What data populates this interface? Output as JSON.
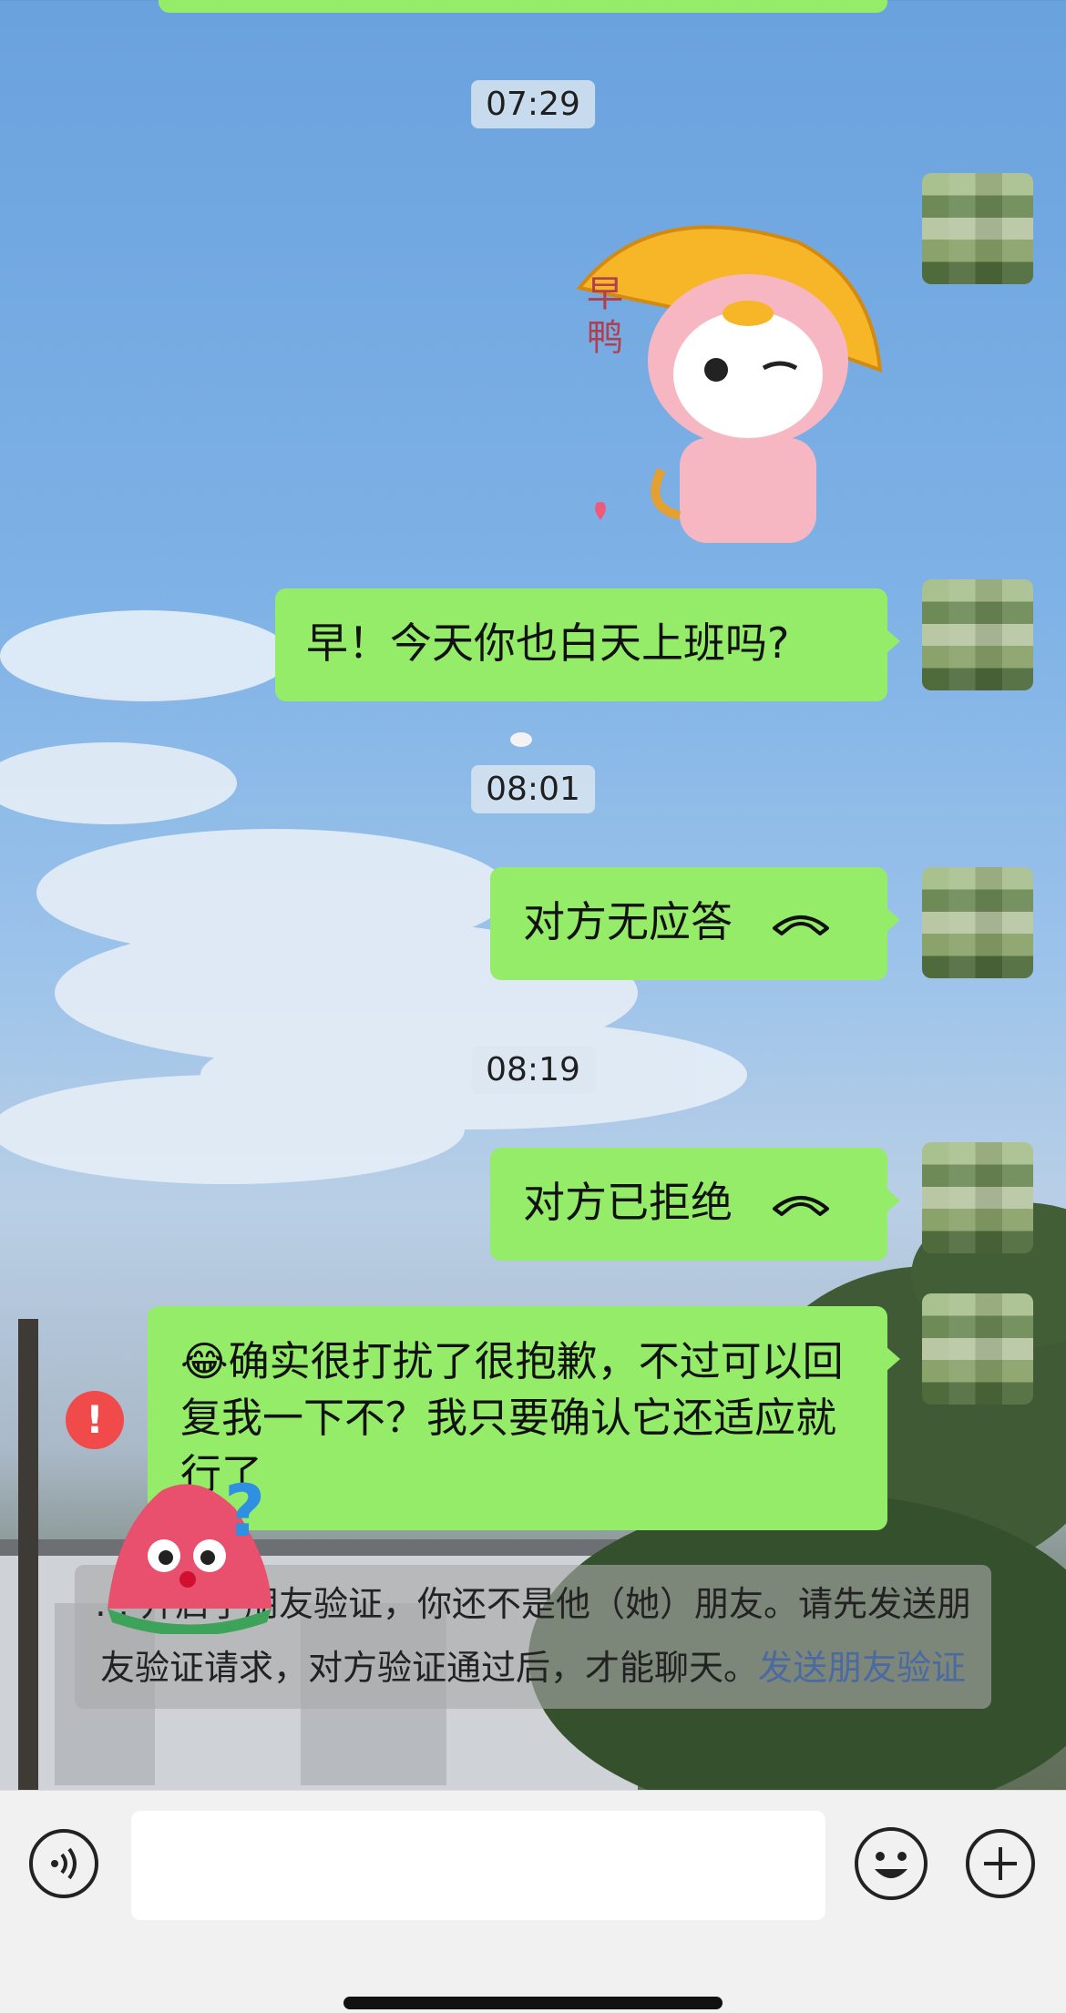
{
  "messages": {
    "top_time": "07:29",
    "msg_morning": "早！今天你也白天上班吗?",
    "time_2": "08:01",
    "call_no_answer": "对方无应答",
    "time_3": "08:19",
    "call_declined": "对方已拒绝",
    "msg_apology_emoji": "😂",
    "msg_apology": "确实很打扰了很抱歉，不过可以回复我一下不？我只要确认它还适应就行了",
    "sticker_text": "早鸭"
  },
  "system_notice": {
    "text": "… 开启了朋友验证，你还不是他（她）朋友。请先发送朋友验证请求，对方验证通过后，才能聊天。",
    "link": "发送朋友验证"
  },
  "input_bar": {
    "voice_icon": "voice-icon",
    "emoji_icon": "emoji-icon",
    "plus_icon": "plus-icon",
    "input_value": ""
  },
  "colors": {
    "bubble_green": "#95ec69",
    "error_red": "#f14a4a",
    "link_blue": "#4a6aa0"
  }
}
